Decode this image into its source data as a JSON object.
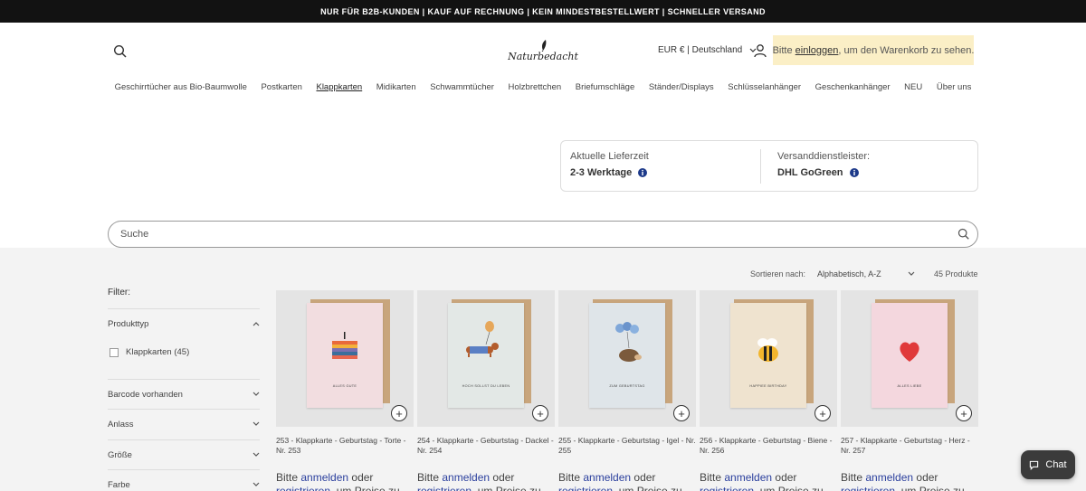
{
  "announcement": "NUR FÜR B2B-KUNDEN | KAUF AUF RECHNUNG | KEIN MINDESTBESTELLWERT | SCHNELLER VERSAND",
  "header": {
    "logo_text": "Naturbedacht",
    "locale": "EUR € | Deutschland",
    "login_prefix": "Bitte ",
    "login_link": "einloggen",
    "login_suffix": ", um den Warenkorb zu sehen."
  },
  "nav": [
    "Geschirrtücher aus Bio-Baumwolle",
    "Postkarten",
    "Klappkarten",
    "Midikarten",
    "Schwammtücher",
    "Holzbrettchen",
    "Briefumschläge",
    "Ständer/Displays",
    "Schlüsselanhänger",
    "Geschenkanhänger",
    "NEU",
    "Über uns"
  ],
  "nav_active": "Klappkarten",
  "delivery": {
    "time_label": "Aktuelle Lieferzeit",
    "time_value": "2-3 Werktage",
    "carrier_label": "Versanddienstleister:",
    "carrier_value": "DHL GoGreen"
  },
  "search": {
    "placeholder": "Suche"
  },
  "sort": {
    "label": "Sortieren nach:",
    "value": "Alphabetisch, A-Z"
  },
  "product_count": "45 Produkte",
  "filter": {
    "title": "Filter:",
    "product_type_label": "Produkttyp",
    "product_type_option": "Klappkarten (45)",
    "facets": [
      "Barcode vorhanden",
      "Anlass",
      "Größe",
      "Farbe"
    ]
  },
  "products": [
    {
      "title": "253 - Klappkarte - Geburtstag - Torte - Nr. 253",
      "card_text": "ALLES GUTE",
      "card_color": "#f2dde0"
    },
    {
      "title": "254 - Klappkarte - Geburtstag - Dackel - Nr. 254",
      "card_text": "HOCH SOLLST DU LEBEN",
      "card_color": "#e3e8e6"
    },
    {
      "title": "255 - Klappkarte - Geburtstag - Igel - Nr. 255",
      "card_text": "ZUM GEBURTSTAG",
      "card_color": "#dfe5e9"
    },
    {
      "title": "256 - Klappkarte - Geburtstag - Biene - Nr. 256",
      "card_text": "HAPPIEE BIRTHDAY",
      "card_color": "#efe3cf"
    },
    {
      "title": "257 - Klappkarte - Geburtstag - Herz - Nr. 257",
      "card_text": "ALLES LIEBE",
      "card_color": "#f4d7de"
    }
  ],
  "price_text": {
    "prefix": "Bitte ",
    "login": "anmelden",
    "middle": " oder",
    "register": "registrieren",
    "suffix": ", um Preise zu"
  },
  "chat_label": "Chat"
}
